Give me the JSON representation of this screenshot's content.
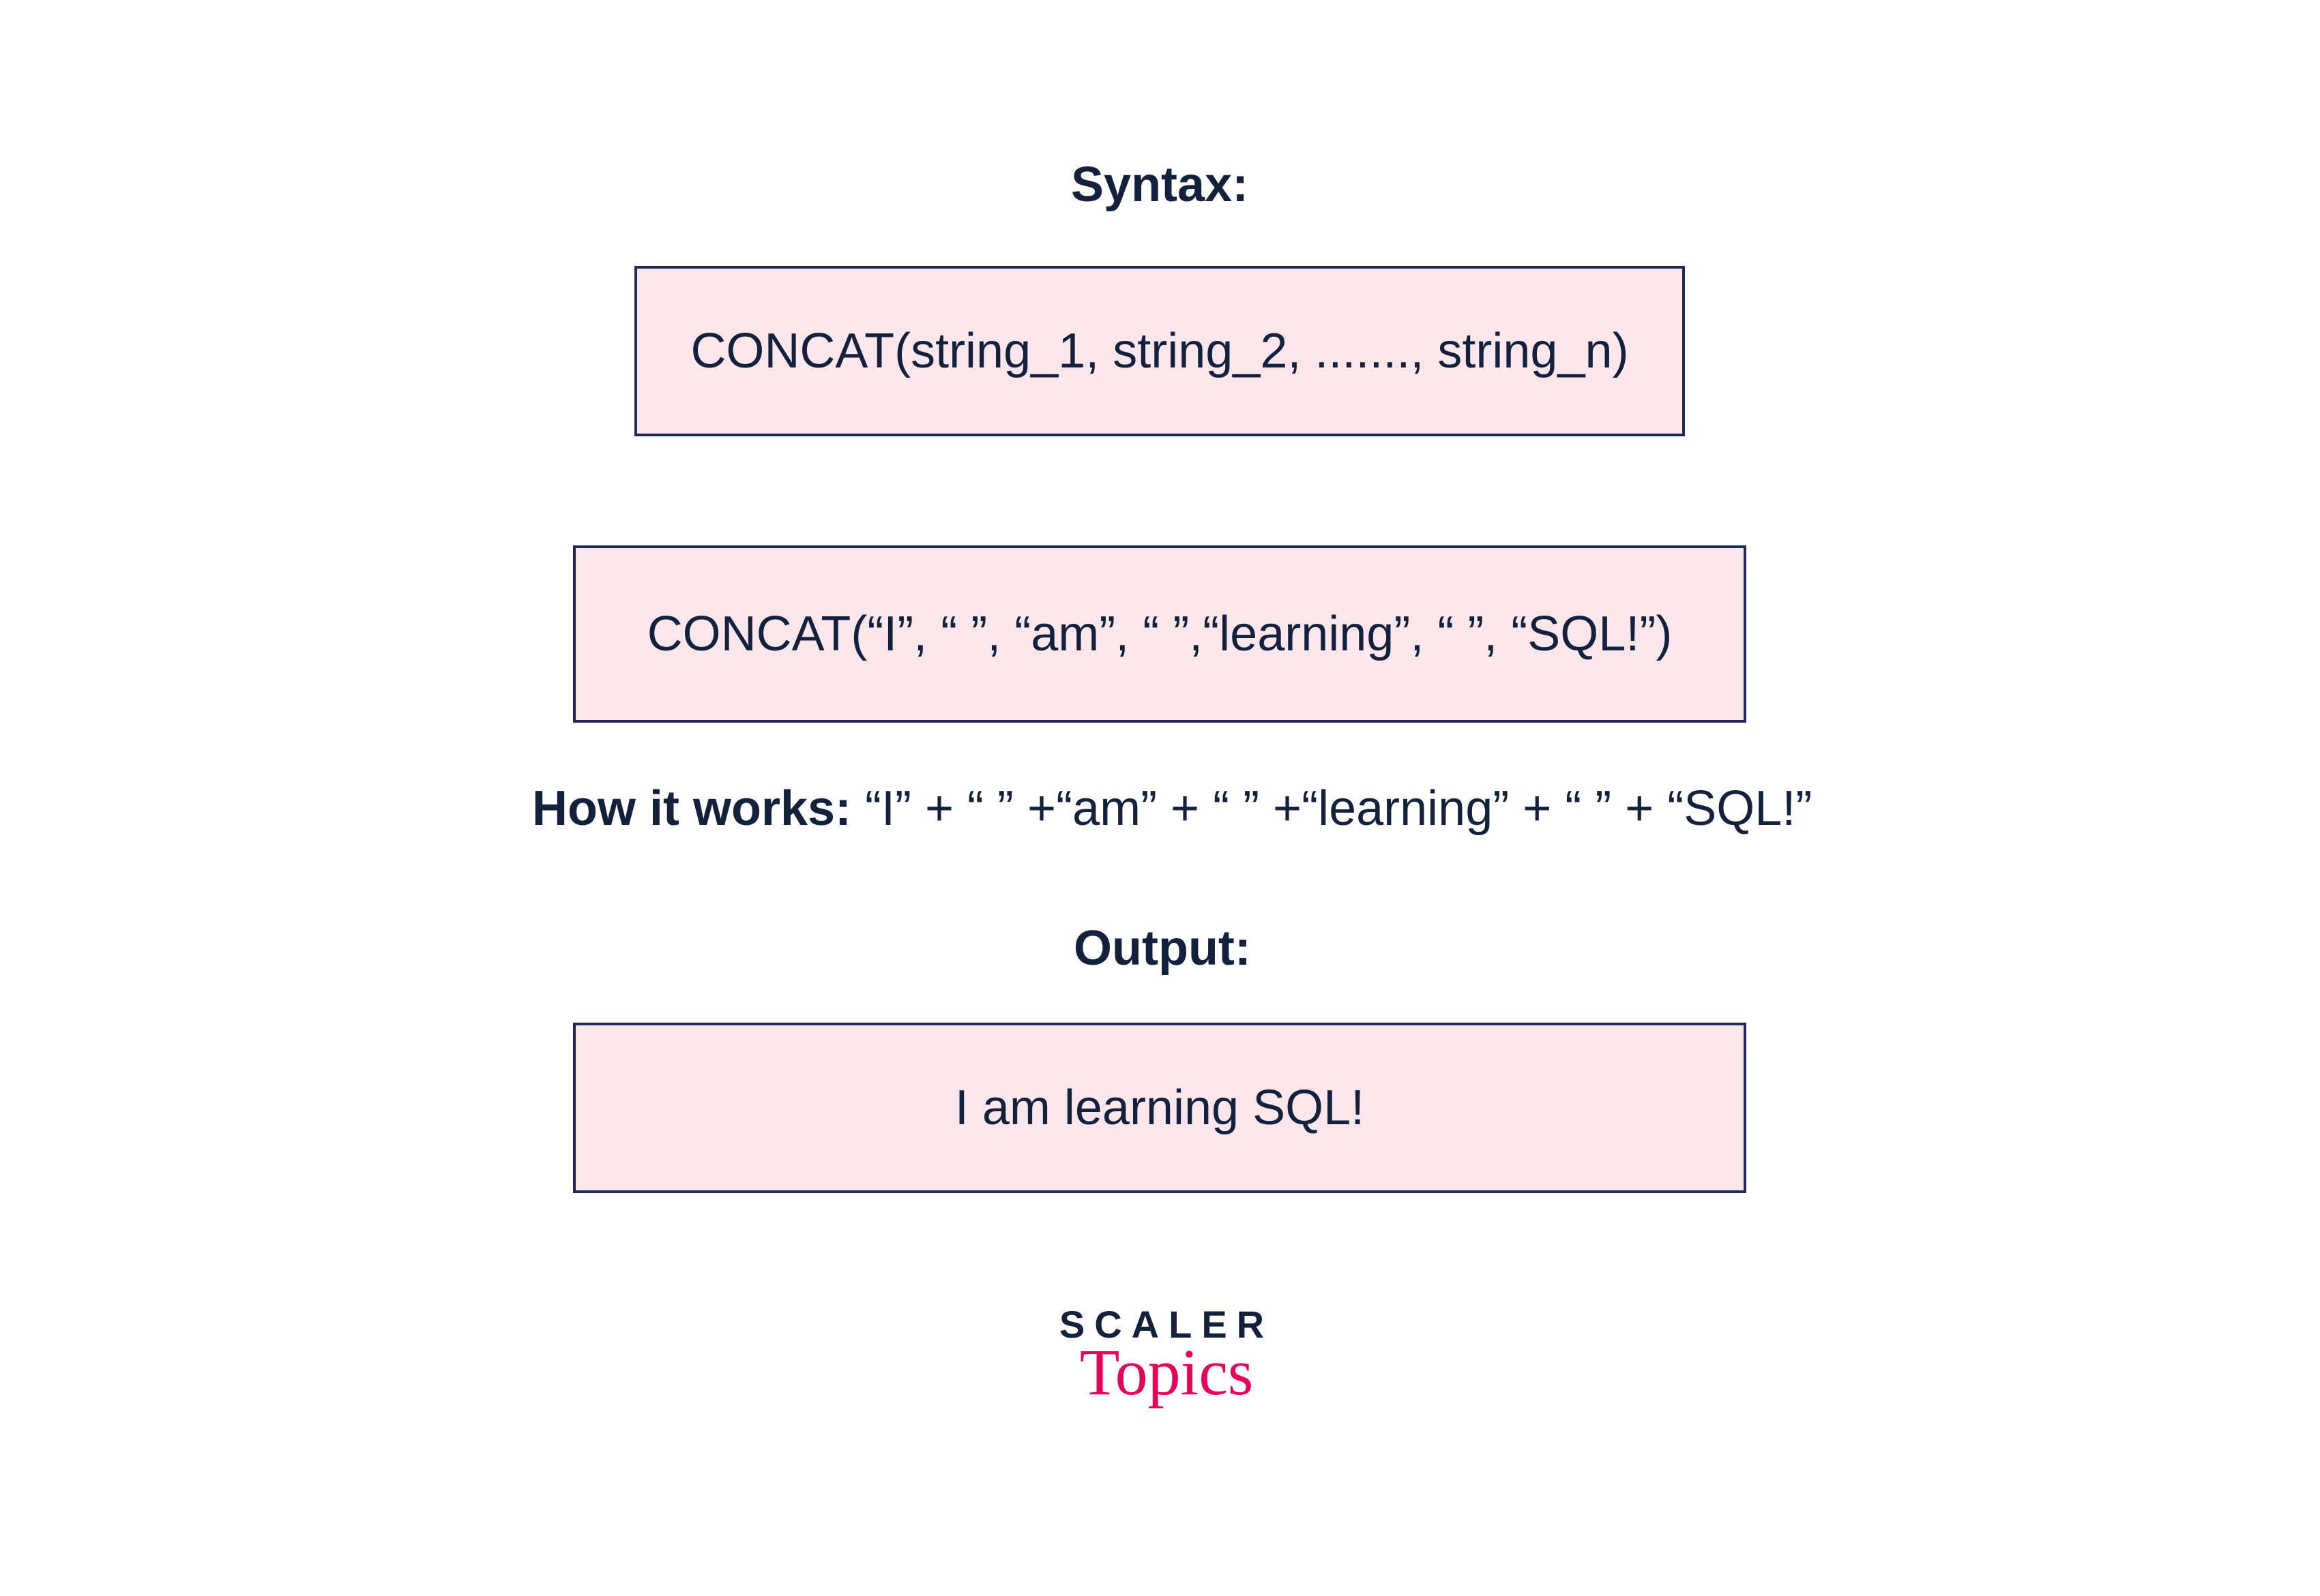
{
  "syntax": {
    "heading": "Syntax:",
    "box": "CONCAT(string_1, string_2, ......., string_n)"
  },
  "example": {
    "box": "CONCAT(“I”, “ ”, “am”, “ ”,“learning”, “ ”, “SQL!”)"
  },
  "how": {
    "label": "How it works: ",
    "expr": "“I” + “ ” +“am” + “ ” +“learning” + “ ” + “SQL!”"
  },
  "output": {
    "heading": "Output:",
    "box": "I am learning SQL!"
  },
  "logo": {
    "scaler": "SCALER",
    "topics": "Topics"
  }
}
